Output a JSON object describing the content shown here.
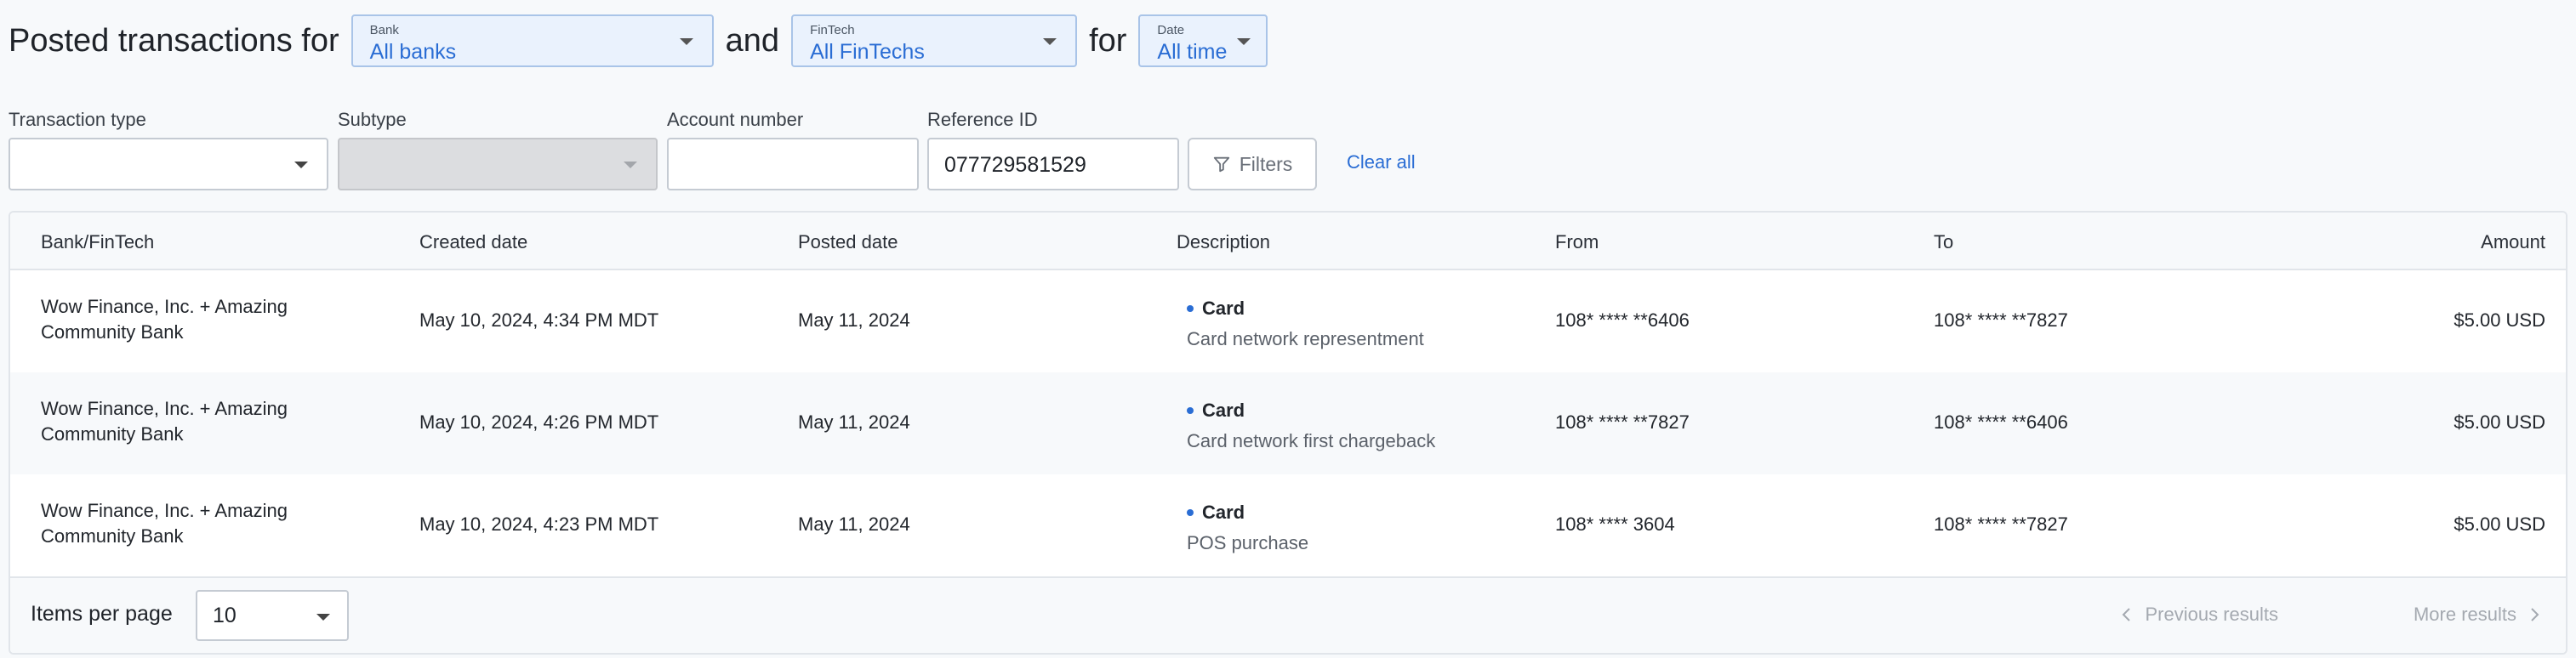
{
  "header": {
    "prefix": "Posted transactions for",
    "and": "and",
    "for": "for",
    "bank": {
      "label": "Bank",
      "value": "All banks"
    },
    "fintech": {
      "label": "FinTech",
      "value": "All FinTechs"
    },
    "date": {
      "label": "Date",
      "value": "All time"
    }
  },
  "filters": {
    "transaction_type": {
      "label": "Transaction type",
      "value": ""
    },
    "subtype": {
      "label": "Subtype",
      "value": ""
    },
    "account_number": {
      "label": "Account number",
      "value": ""
    },
    "reference_id": {
      "label": "Reference ID",
      "value": "077729581529"
    },
    "filters_button": "Filters",
    "clear_all": "Clear all"
  },
  "table": {
    "columns": [
      "Bank/FinTech",
      "Created date",
      "Posted date",
      "Description",
      "From",
      "To",
      "Amount"
    ],
    "rows": [
      {
        "bank": "Wow Finance, Inc. + Amazing Community Bank",
        "created": "May 10, 2024, 4:34 PM MDT",
        "posted": "May 11, 2024",
        "desc_title": "Card",
        "desc_sub": "Card network representment",
        "from": "108* **** **6406",
        "to": "108* **** **7827",
        "amount": "$5.00 USD"
      },
      {
        "bank": "Wow Finance, Inc. + Amazing Community Bank",
        "created": "May 10, 2024, 4:26 PM MDT",
        "posted": "May 11, 2024",
        "desc_title": "Card",
        "desc_sub": "Card network first chargeback",
        "from": "108* **** **7827",
        "to": "108* **** **6406",
        "amount": "$5.00 USD"
      },
      {
        "bank": "Wow Finance, Inc. + Amazing Community Bank",
        "created": "May 10, 2024, 4:23 PM MDT",
        "posted": "May 11, 2024",
        "desc_title": "Card",
        "desc_sub": "POS purchase",
        "from": "108* **** 3604",
        "to": "108* **** **7827",
        "amount": "$5.00 USD"
      }
    ]
  },
  "footer": {
    "items_per_page_label": "Items per page",
    "items_per_page_value": "10",
    "previous": "Previous results",
    "more": "More results"
  },
  "colors": {
    "accent": "#2a6dd4",
    "background": "#f7f9fb"
  }
}
